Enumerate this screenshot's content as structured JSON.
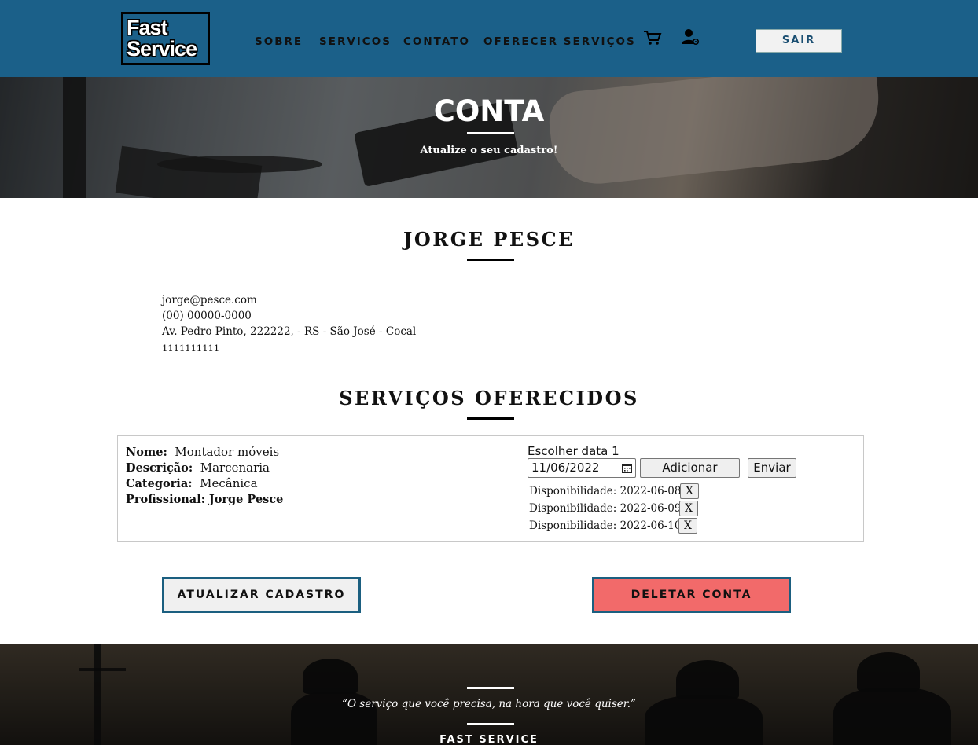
{
  "header": {
    "logo_line1": "Fast",
    "logo_line2": "Service",
    "nav": {
      "sobre": "SOBRE",
      "servicos": "SERVICOS",
      "contato": "CONTATO",
      "oferecer": "OFERECER SERVIÇOS"
    },
    "icons": {
      "cart": "cart-icon",
      "user": "user-settings-icon"
    },
    "logout_label": "SAIR",
    "colors": {
      "bar": "#1b6089",
      "logout_text": "#1b4f72"
    }
  },
  "hero": {
    "title": "CONTA",
    "subtitle": "Atualize o seu cadastro!"
  },
  "profile": {
    "name": "JORGE PESCE",
    "email": "jorge@pesce.com",
    "phone": "(00) 00000-0000",
    "address": "Av. Pedro Pinto, 222222, - RS - São José - Cocal",
    "document": "1111111111"
  },
  "services": {
    "title": "SERVIÇOS OFERECIDOS",
    "items": [
      {
        "nome_label": "Nome:",
        "nome": "Montador móveis",
        "descricao_label": "Descrição:",
        "descricao": "Marcenaria",
        "categoria_label": "Categoria:",
        "categoria": "Mecânica",
        "profissional_label": "Profissional:",
        "profissional": "Jorge Pesce",
        "date_label": "Escolher data 1",
        "date_value": "11/06/2022",
        "add_label": "Adicionar",
        "send_label": "Enviar",
        "availability": [
          {
            "label": "Disponibilidade:",
            "date": "2022-06-08",
            "remove": "X"
          },
          {
            "label": "Disponibilidade:",
            "date": "2022-06-09",
            "remove": "X"
          },
          {
            "label": "Disponibilidade:",
            "date": "2022-06-10",
            "remove": "X"
          }
        ]
      }
    ]
  },
  "actions": {
    "update_label": "ATUALIZAR CADASTRO",
    "delete_label": "DELETAR CONTA",
    "colors": {
      "delete_bg": "#f26a6a",
      "border": "#1b5f80"
    }
  },
  "footer": {
    "quote": "“O serviço que você precisa, na hora que você quiser.”",
    "brand": "FAST SERVICE"
  }
}
